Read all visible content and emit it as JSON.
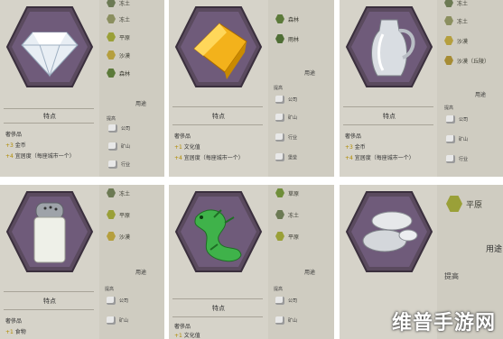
{
  "cards": [
    {
      "name": "diamond",
      "terrains": [
        {
          "label": "冻土",
          "color": "#6c7a54"
        },
        {
          "label": "冻土",
          "color": "#8b8f5f"
        },
        {
          "label": "平原",
          "color": "#9aa038"
        },
        {
          "label": "沙漠",
          "color": "#b59f3e"
        },
        {
          "label": "森林",
          "color": "#5c7a3a"
        }
      ],
      "usage": "用途",
      "sections": [
        {
          "title": "提高",
          "items": [
            "公司",
            "矿山",
            "行业"
          ]
        }
      ],
      "feature": "特点",
      "luxury": "奢侈品",
      "lines": [
        {
          "num": "+3",
          "text": "金币"
        },
        {
          "num": "+4",
          "text": "宜居度（每座城市一个）"
        }
      ]
    },
    {
      "name": "gold",
      "terrains": [
        {
          "label": "森林",
          "color": "#5c7a3a"
        },
        {
          "label": "雨林",
          "color": "#4f6e35"
        }
      ],
      "usage": "用途",
      "sections": [
        {
          "title": "提高",
          "items": [
            "公司",
            "矿山",
            "行业",
            "堡垒"
          ]
        }
      ],
      "feature": "特点",
      "luxury": "奢侈品",
      "lines": [
        {
          "num": "+1",
          "text": "文化值"
        },
        {
          "num": "+4",
          "text": "宜居度（每座城市一个）"
        }
      ]
    },
    {
      "name": "jug",
      "terrains": [
        {
          "label": "冻土",
          "color": "#6c7a54"
        },
        {
          "label": "冻土",
          "color": "#8b8f5f"
        },
        {
          "label": "沙漠",
          "color": "#b59f3e"
        },
        {
          "label": "沙漠（丘陵）",
          "color": "#a68c34"
        }
      ],
      "usage": "用途",
      "sections": [
        {
          "title": "提高",
          "items": [
            "公司",
            "矿山",
            "行业"
          ]
        }
      ],
      "feature": "特点",
      "luxury": "奢侈品",
      "lines": [
        {
          "num": "+3",
          "text": "金币"
        },
        {
          "num": "+4",
          "text": "宜居度（每座城市一个）"
        }
      ]
    },
    {
      "name": "salt",
      "terrains": [
        {
          "label": "冻土",
          "color": "#6c7a54"
        },
        {
          "label": "平原",
          "color": "#9aa038"
        },
        {
          "label": "沙漠",
          "color": "#b59f3e"
        }
      ],
      "usage": "用途",
      "sections": [
        {
          "title": "提高",
          "items": [
            "公司",
            "矿山"
          ]
        }
      ],
      "feature": "特点",
      "luxury": "奢侈品",
      "lines": [
        {
          "num": "+1",
          "text": "食物"
        }
      ]
    },
    {
      "name": "jade",
      "terrains": [
        {
          "label": "草原",
          "color": "#6f8e3a"
        },
        {
          "label": "冻土",
          "color": "#6c7a54"
        },
        {
          "label": "平原",
          "color": "#9aa038"
        }
      ],
      "usage": "用途",
      "sections": [
        {
          "title": "提高",
          "items": [
            "公司",
            "矿山"
          ]
        }
      ],
      "feature": "特点",
      "luxury": "奢侈品",
      "lines": [
        {
          "num": "+1",
          "text": "文化值"
        }
      ]
    },
    {
      "name": "silver",
      "terrains": [
        {
          "label": "平原",
          "color": "#9aa038"
        }
      ],
      "usage": "用途",
      "sections": [
        {
          "title": "提高",
          "items": []
        }
      ],
      "feature": "",
      "luxury": "",
      "lines": []
    }
  ],
  "watermark": "维普手游网"
}
